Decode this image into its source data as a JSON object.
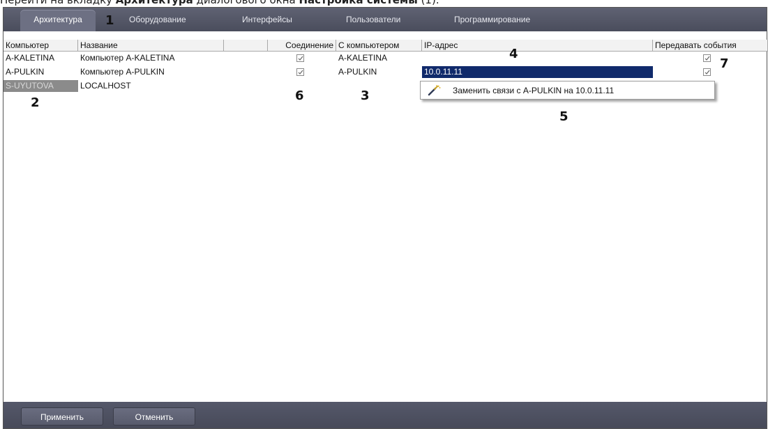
{
  "caption": {
    "prefix": "Перейти на вкладку ",
    "bold1": "Архитектура",
    "middle": " диалогового окна ",
    "bold2": "Настройка системы",
    "suffix": " (1)."
  },
  "tabs": [
    {
      "label": "Архитектура",
      "active": true
    },
    {
      "label": "Оборудование",
      "active": false
    },
    {
      "label": "Интерфейсы",
      "active": false
    },
    {
      "label": "Пользователи",
      "active": false
    },
    {
      "label": "Программирование",
      "active": false
    }
  ],
  "table": {
    "columns": [
      "Компьютер",
      "Название",
      "",
      "Соединение",
      "С компьютером",
      "IP-адрес",
      "Передавать события"
    ],
    "rows": [
      {
        "computer": "A-KALETINA",
        "name": "Компьютер A-KALETINA",
        "connection": true,
        "with_computer": "A-KALETINA",
        "ip": "",
        "send_events": true
      },
      {
        "computer": "A-PULKIN",
        "name": "Компьютер A-PULKIN",
        "connection": true,
        "with_computer": "A-PULKIN",
        "ip": "10.0.11.11",
        "send_events": true
      },
      {
        "computer": "S-UYUTOVA",
        "name": "LOCALHOST",
        "connection": null,
        "with_computer": "",
        "ip": "",
        "send_events": null
      }
    ]
  },
  "context_menu": {
    "item": "Заменить связи с A-PULKIN на 10.0.11.11",
    "icon": "wrench-icon"
  },
  "annotations": [
    "1",
    "2",
    "3",
    "4",
    "5",
    "6",
    "7"
  ],
  "buttons": {
    "apply": "Применить",
    "cancel": "Отменить"
  },
  "colors": {
    "tabbar": "#4f5262",
    "selection": "#102a6b",
    "selected_row": "#8b8b8b"
  }
}
